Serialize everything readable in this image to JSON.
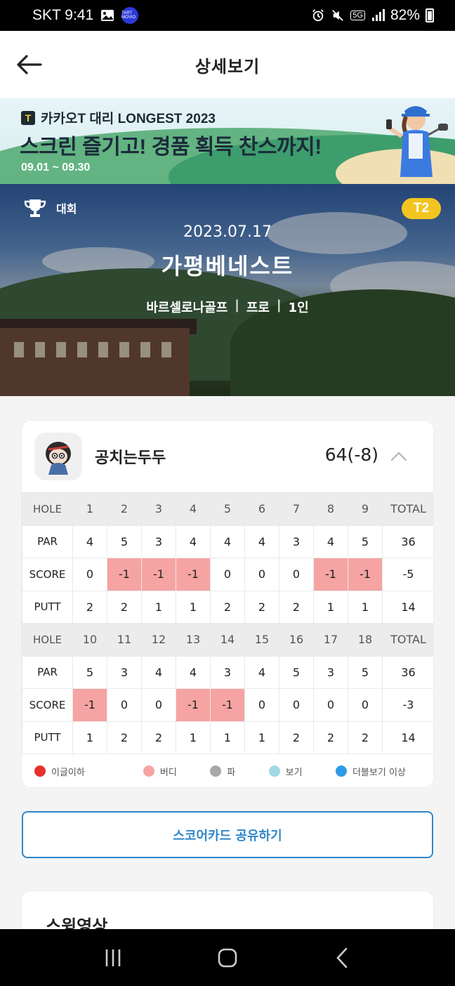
{
  "status_bar": {
    "carrier_time": "SKT 9:41",
    "tart_label": "TART MOVIO",
    "network": "5G",
    "battery": "82%"
  },
  "header": {
    "title": "상세보기"
  },
  "banner": {
    "brand": "카카오T 대리 LONGEST 2023",
    "logo_letter": "T",
    "headline": "스크린 즐기고! 경품 획득 찬스까지!",
    "dates": "09.01 ~ 09.30"
  },
  "round": {
    "category": "대회",
    "tee": "T2",
    "date": "2023.07.17",
    "course": "가평베네스트",
    "system": "바르셀로나골프",
    "level": "프로",
    "players": "1인"
  },
  "scorecard": {
    "player_name": "공치는두두",
    "total": "64(-8)",
    "front": {
      "hole_label": "HOLE",
      "holes": [
        "1",
        "2",
        "3",
        "4",
        "5",
        "6",
        "7",
        "8",
        "9"
      ],
      "total_label": "TOTAL",
      "par_label": "PAR",
      "par": [
        "4",
        "5",
        "3",
        "4",
        "4",
        "4",
        "3",
        "4",
        "5"
      ],
      "par_total": "36",
      "score_label": "SCORE",
      "score": [
        "0",
        "-1",
        "-1",
        "-1",
        "0",
        "0",
        "0",
        "-1",
        "-1"
      ],
      "score_total": "-5",
      "putt_label": "PUTT",
      "putt": [
        "2",
        "2",
        "1",
        "1",
        "2",
        "2",
        "2",
        "1",
        "1"
      ],
      "putt_total": "14"
    },
    "back": {
      "hole_label": "HOLE",
      "holes": [
        "10",
        "11",
        "12",
        "13",
        "14",
        "15",
        "16",
        "17",
        "18"
      ],
      "total_label": "TOTAL",
      "par_label": "PAR",
      "par": [
        "5",
        "3",
        "4",
        "4",
        "3",
        "4",
        "5",
        "3",
        "5"
      ],
      "par_total": "36",
      "score_label": "SCORE",
      "score": [
        "-1",
        "0",
        "0",
        "-1",
        "-1",
        "0",
        "0",
        "0",
        "0"
      ],
      "score_total": "-3",
      "putt_label": "PUTT",
      "putt": [
        "1",
        "2",
        "2",
        "1",
        "1",
        "1",
        "2",
        "2",
        "2"
      ],
      "putt_total": "14"
    },
    "legend": [
      {
        "label": "이글이하",
        "color": "#e8302a"
      },
      {
        "label": "버디",
        "color": "#f6a4a3"
      },
      {
        "label": "파",
        "color": "#a8a8a8"
      },
      {
        "label": "보기",
        "color": "#9fd9e3"
      },
      {
        "label": "더블보기 이상",
        "color": "#2f9be6"
      }
    ],
    "birdie_color": "#f6a4a3"
  },
  "share_button": "스코어카드 공유하기",
  "swing_section": {
    "title": "스윙영상"
  }
}
